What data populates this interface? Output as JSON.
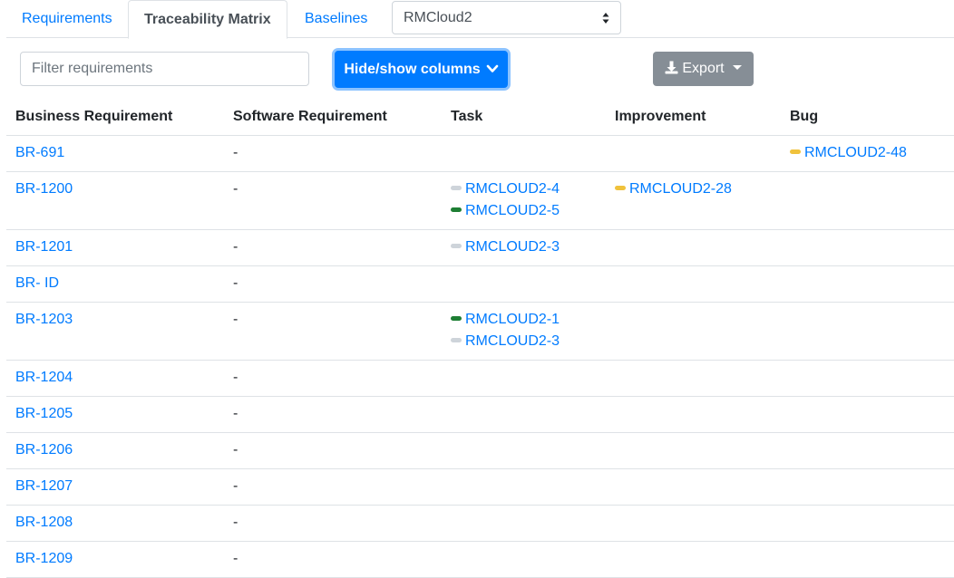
{
  "tabs": [
    {
      "label": "Requirements",
      "active": false
    },
    {
      "label": "Traceability Matrix",
      "active": true
    },
    {
      "label": "Baselines",
      "active": false
    }
  ],
  "project_select": {
    "value": "RMCloud2"
  },
  "filter": {
    "placeholder": "Filter requirements",
    "value": ""
  },
  "columns_button": {
    "label": "Hide/show columns",
    "icon": "chevron-down-icon"
  },
  "export_button": {
    "label": "Export",
    "icon": "download-icon"
  },
  "status_colors": {
    "gray": "#ced4da",
    "green": "#1e7e34",
    "yellow": "#f0c23c"
  },
  "table": {
    "headers": [
      "Business Requirement",
      "Software Requirement",
      "Task",
      "Improvement",
      "Bug"
    ],
    "rows": [
      {
        "br": "BR-691",
        "sr": "-",
        "tasks": [],
        "improvements": [],
        "bugs": [
          {
            "id": "RMCLOUD2-48",
            "status": "yellow"
          }
        ]
      },
      {
        "br": "BR-1200",
        "sr": "-",
        "tasks": [
          {
            "id": "RMCLOUD2-4",
            "status": "gray"
          },
          {
            "id": "RMCLOUD2-5",
            "status": "green"
          }
        ],
        "improvements": [
          {
            "id": "RMCLOUD2-28",
            "status": "yellow"
          }
        ],
        "bugs": []
      },
      {
        "br": "BR-1201",
        "sr": "-",
        "tasks": [
          {
            "id": "RMCLOUD2-3",
            "status": "gray"
          }
        ],
        "improvements": [],
        "bugs": []
      },
      {
        "br": "BR- ID",
        "sr": "-",
        "tasks": [],
        "improvements": [],
        "bugs": []
      },
      {
        "br": "BR-1203",
        "sr": "-",
        "tasks": [
          {
            "id": "RMCLOUD2-1",
            "status": "green"
          },
          {
            "id": "RMCLOUD2-3",
            "status": "gray"
          }
        ],
        "improvements": [],
        "bugs": []
      },
      {
        "br": "BR-1204",
        "sr": "-",
        "tasks": [],
        "improvements": [],
        "bugs": []
      },
      {
        "br": "BR-1205",
        "sr": "-",
        "tasks": [],
        "improvements": [],
        "bugs": []
      },
      {
        "br": "BR-1206",
        "sr": "-",
        "tasks": [],
        "improvements": [],
        "bugs": []
      },
      {
        "br": "BR-1207",
        "sr": "-",
        "tasks": [],
        "improvements": [],
        "bugs": []
      },
      {
        "br": "BR-1208",
        "sr": "-",
        "tasks": [],
        "improvements": [],
        "bugs": []
      },
      {
        "br": "BR-1209",
        "sr": "-",
        "tasks": [],
        "improvements": [],
        "bugs": []
      }
    ]
  }
}
